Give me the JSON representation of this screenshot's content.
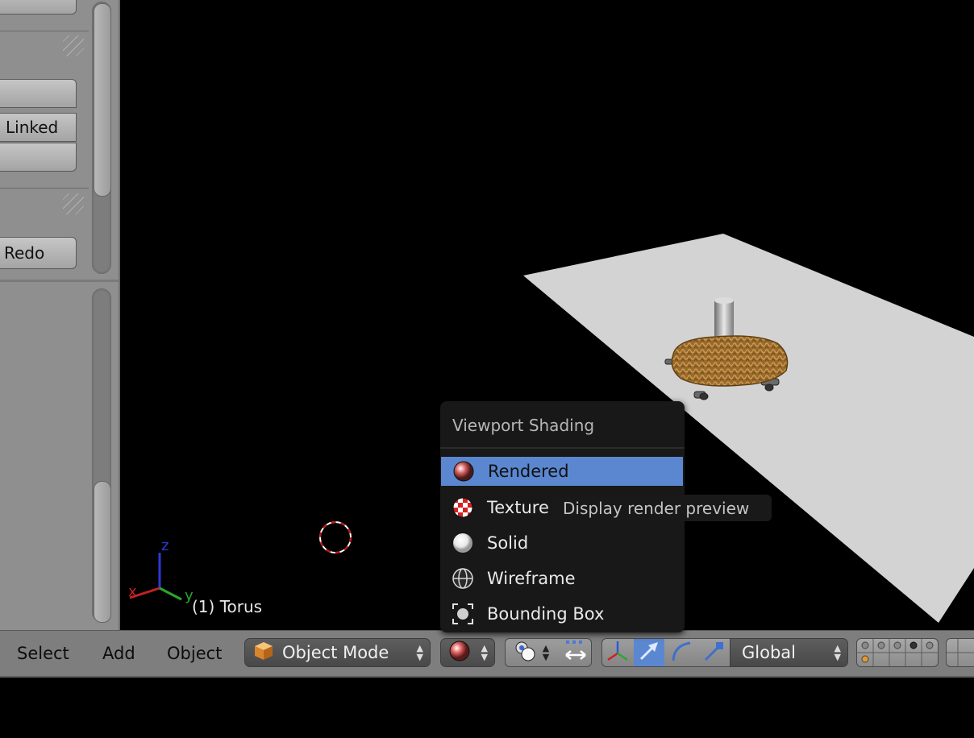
{
  "shelf": {
    "buttons": [
      {
        "label": ""
      },
      {
        "label": ""
      },
      {
        "label": "Linked"
      },
      {
        "label": ""
      },
      {
        "label": "Redo"
      }
    ]
  },
  "viewport": {
    "object_label": "(1) Torus",
    "axes": {
      "x": "x",
      "y": "y",
      "z": "z"
    }
  },
  "header": {
    "menus": [
      "Select",
      "Add",
      "Object"
    ],
    "mode": "Object Mode",
    "orientation": "Global"
  },
  "popup": {
    "title": "Viewport Shading",
    "items": [
      {
        "label": "Rendered",
        "icon": "rendered-sphere-icon",
        "active": true
      },
      {
        "label": "Texture",
        "icon": "texture-checker-icon",
        "active": false
      },
      {
        "label": "Solid",
        "icon": "solid-sphere-icon",
        "active": false
      },
      {
        "label": "Wireframe",
        "icon": "wireframe-sphere-icon",
        "active": false
      },
      {
        "label": "Bounding Box",
        "icon": "bounding-box-icon",
        "active": false
      }
    ],
    "tooltip": "Display render preview"
  },
  "colors": {
    "highlight": "#5a87d0",
    "header_bg": "#7e7e7e",
    "shelf_bg": "#8f8f8f",
    "popup_bg": "#181818"
  }
}
